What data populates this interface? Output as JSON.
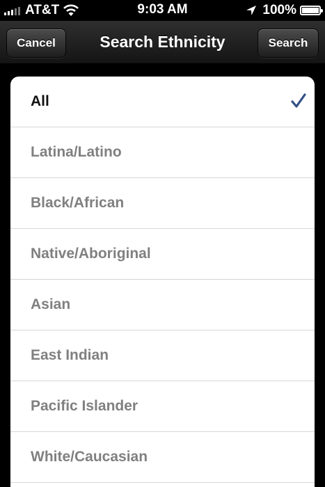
{
  "status_bar": {
    "carrier": "AT&T",
    "time": "9:03 AM",
    "battery": "100%",
    "battery_level": 1.0,
    "icons": [
      "signal-bars-icon",
      "wifi-icon",
      "location-arrow-icon",
      "battery-icon"
    ]
  },
  "nav": {
    "title": "Search Ethnicity",
    "cancel_label": "Cancel",
    "search_label": "Search"
  },
  "ethnicity_list": {
    "selected_index": 0,
    "items": [
      {
        "label": "All",
        "selected": true
      },
      {
        "label": "Latina/Latino",
        "selected": false
      },
      {
        "label": "Black/African",
        "selected": false
      },
      {
        "label": "Native/Aboriginal",
        "selected": false
      },
      {
        "label": "Asian",
        "selected": false
      },
      {
        "label": "East Indian",
        "selected": false
      },
      {
        "label": "Pacific Islander",
        "selected": false
      },
      {
        "label": "White/Caucasian",
        "selected": false
      }
    ]
  },
  "colors": {
    "checkmark": "#324f85",
    "selected_text": "#111111",
    "unselected_text": "#808080",
    "background": "#000000"
  }
}
